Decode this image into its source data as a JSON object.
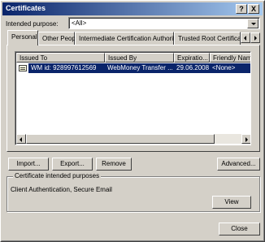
{
  "window": {
    "title": "Certificates",
    "help_button": "?",
    "close_button": "X"
  },
  "purpose": {
    "label": "Intended purpose:",
    "selected": "<All>"
  },
  "tabs": [
    {
      "label": "Personal",
      "active": true
    },
    {
      "label": "Other People"
    },
    {
      "label": "Intermediate Certification Authorities"
    },
    {
      "label": "Trusted Root Certification"
    }
  ],
  "list": {
    "columns": [
      "Issued To",
      "Issued By",
      "Expiratio...",
      "Friendly Name"
    ],
    "rows": [
      {
        "issued_to": "WM id: 928997612569",
        "issued_by": "WebMoney Transfer ...",
        "expiration": "29.06.2008",
        "friendly_name": "<None>",
        "selected": true
      }
    ]
  },
  "buttons": {
    "import": "Import...",
    "export": "Export...",
    "remove": "Remove",
    "advanced": "Advanced...",
    "view": "View",
    "close": "Close"
  },
  "purposes_group": {
    "title": "Certificate intended purposes",
    "text": "Client Authentication, Secure Email"
  },
  "colors": {
    "title_start": "#0a246a",
    "title_end": "#a6caf0",
    "selection": "#0a246a",
    "face": "#d4d0c8"
  }
}
